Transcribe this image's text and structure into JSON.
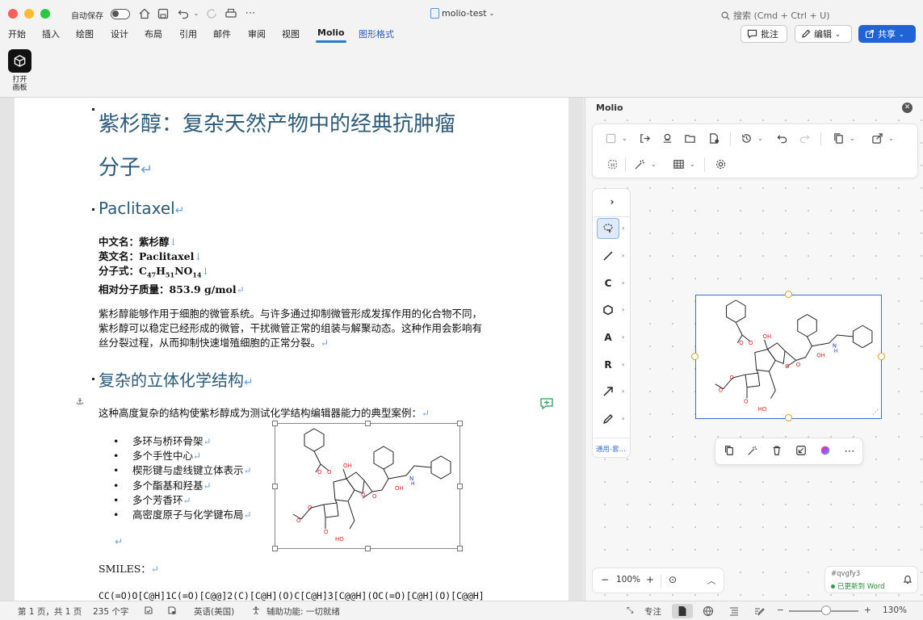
{
  "titlebar": {
    "autosave_label": "自动保存",
    "doc_title": "molio-test",
    "search_placeholder": "搜索 (Cmd + Ctrl + U)"
  },
  "ribbon": {
    "tabs": [
      "开始",
      "插入",
      "绘图",
      "设计",
      "布局",
      "引用",
      "邮件",
      "审阅",
      "视图",
      "Molio",
      "图形格式"
    ],
    "active_tab": "Molio",
    "comment_label": "批注",
    "edit_label": "编辑",
    "share_label": "共享",
    "open_board_label_1": "打开",
    "open_board_label_2": "画板"
  },
  "document": {
    "title_line1": "紫杉醇：复杂天然产物中的经典抗肿瘤",
    "title_line2": "分子",
    "subtitle_en": "Paclitaxel",
    "info": {
      "cn_name_label": "中文名：",
      "cn_name": "紫杉醇",
      "en_name_label": "英文名：",
      "en_name": "Paclitaxel",
      "formula_label": "分子式：",
      "mass_label": "相对分子质量：",
      "mass": "853.9 g/mol"
    },
    "paragraph1": "紫杉醇能够作用于细胞的微管系统。与许多通过抑制微管形成发挥作用的化合物不同，紫杉醇可以稳定已经形成的微管，干扰微管正常的组装与解聚动态。这种作用会影响有丝分裂过程，从而抑制快速增殖细胞的正常分裂。",
    "heading2": "复杂的立体化学结构",
    "paragraph2": "这种高度复杂的结构使紫杉醇成为测试化学结构编辑器能力的典型案例：",
    "list": [
      "多环与桥环骨架",
      "多个手性中心",
      "楔形键与虚线键立体表示",
      "多个酯基和羟基",
      "多个芳香环",
      "高密度原子与化学键布局"
    ],
    "smiles_label": "SMILES：",
    "smiles_partial": "CC(=O)O[C@H]1C(=O)[C@@]2(C)[C@H](O)C[C@H]3[C@@H](OC(=O)[C@H](O)[C@@H]"
  },
  "panel": {
    "title": "Molio",
    "tools_footer": "通用-套...",
    "tool_letters": [
      "C",
      "A",
      "R"
    ],
    "zoom": "100%",
    "doc_id": "#qvgfy3",
    "sync_status": "已更新到 Word"
  },
  "statusbar": {
    "page": "第 1 页，共 1 页",
    "words": "235 个字",
    "language": "英语(美国)",
    "accessibility": "辅助功能: 一切就绪",
    "focus": "专注",
    "zoom": "130%"
  },
  "colors": {
    "heading": "#2d5a78",
    "accent": "#1f63d6",
    "selection": "#3b6fd6",
    "handle": "#e0a020"
  }
}
